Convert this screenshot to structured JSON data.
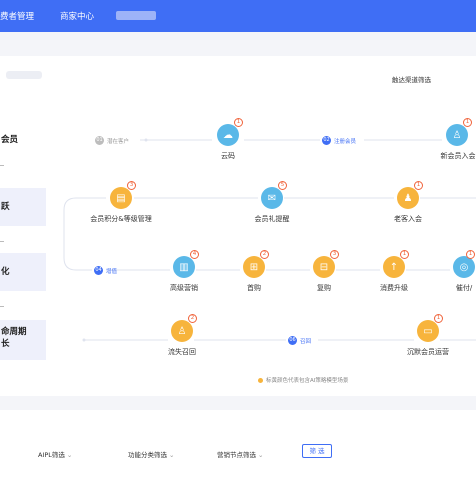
{
  "topnav": {
    "items": [
      "费者管理",
      "商家中心"
    ],
    "redacted_label": ""
  },
  "filter_label": "触达渠道筛选",
  "sidebar": [
    {
      "label": "会员",
      "selected": false
    },
    {
      "label": "跃",
      "selected": true
    },
    {
      "label": "化",
      "selected": true
    },
    {
      "label": "命周期\n长",
      "selected": true
    }
  ],
  "stages": [
    {
      "num": "01",
      "text": "潜在客户",
      "color": "gray"
    },
    {
      "num": "02",
      "text": "注册会员",
      "color": "blue"
    },
    {
      "num": "04",
      "text": "增值",
      "color": "blue"
    },
    {
      "num": "06",
      "text": "召回",
      "color": "blue"
    }
  ],
  "nodes": [
    {
      "label": "云码",
      "badge": "1",
      "color": "blue",
      "icon": "cloud-icon"
    },
    {
      "label": "新会员入会",
      "badge": "1",
      "color": "blue",
      "icon": "user-add-icon"
    },
    {
      "label": "会员积分&等级管理",
      "badge": "3",
      "color": "orange",
      "icon": "points-icon"
    },
    {
      "label": "会员礼提醒",
      "badge": "5",
      "color": "blue",
      "icon": "gift-icon"
    },
    {
      "label": "老客入会",
      "badge": "1",
      "color": "orange",
      "icon": "returning-user-icon"
    },
    {
      "label": "高级营销",
      "badge": "4",
      "color": "blue",
      "icon": "factory-icon"
    },
    {
      "label": "首购",
      "badge": "2",
      "color": "orange",
      "icon": "cart-icon"
    },
    {
      "label": "复购",
      "badge": "3",
      "color": "orange",
      "icon": "bag-icon"
    },
    {
      "label": "消费升级",
      "badge": "1",
      "color": "orange",
      "icon": "upgrade-icon"
    },
    {
      "label": "催付/",
      "badge": "1",
      "color": "blue",
      "icon": "bell-icon"
    },
    {
      "label": "流失召回",
      "badge": "2",
      "color": "orange",
      "icon": "recall-icon"
    },
    {
      "label": "沉默会员运营",
      "badge": "1",
      "color": "orange",
      "icon": "message-icon"
    }
  ],
  "legend": "标黄颜色代表包含AI策略模型场景",
  "bottom_filters": [
    "AIPL筛选",
    "功能分类筛选",
    "营销节点筛选"
  ],
  "filter_button": "筛 选",
  "colors": {
    "primary": "#3f6ef5",
    "node_blue": "#5ab8e8",
    "node_orange": "#f7b43c",
    "badge": "#f0643c"
  }
}
